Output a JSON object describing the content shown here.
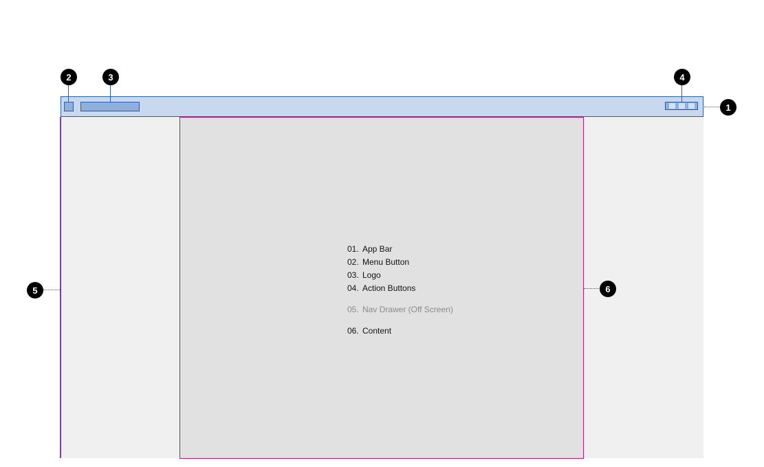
{
  "badges": {
    "b1": "1",
    "b2": "2",
    "b3": "3",
    "b4": "4",
    "b5": "5",
    "b6": "6"
  },
  "legend": [
    {
      "num": "01.",
      "label": "App Bar"
    },
    {
      "num": "02.",
      "label": "Menu Button"
    },
    {
      "num": "03.",
      "label": "Logo"
    },
    {
      "num": "04.",
      "label": "Action Buttons"
    },
    {
      "num": "05.",
      "label": "Nav Drawer (Off Screen)"
    },
    {
      "num": "06.",
      "label": "Content"
    }
  ],
  "colors": {
    "app_bar_fill": "#c8d8ee",
    "app_bar_stroke": "#2a5ea8",
    "nav_drawer_stroke": "#7a3fb8",
    "content_stroke": "#c0157e",
    "content_fill": "#e1e1e1",
    "viewport_fill": "#f0f0f0"
  }
}
